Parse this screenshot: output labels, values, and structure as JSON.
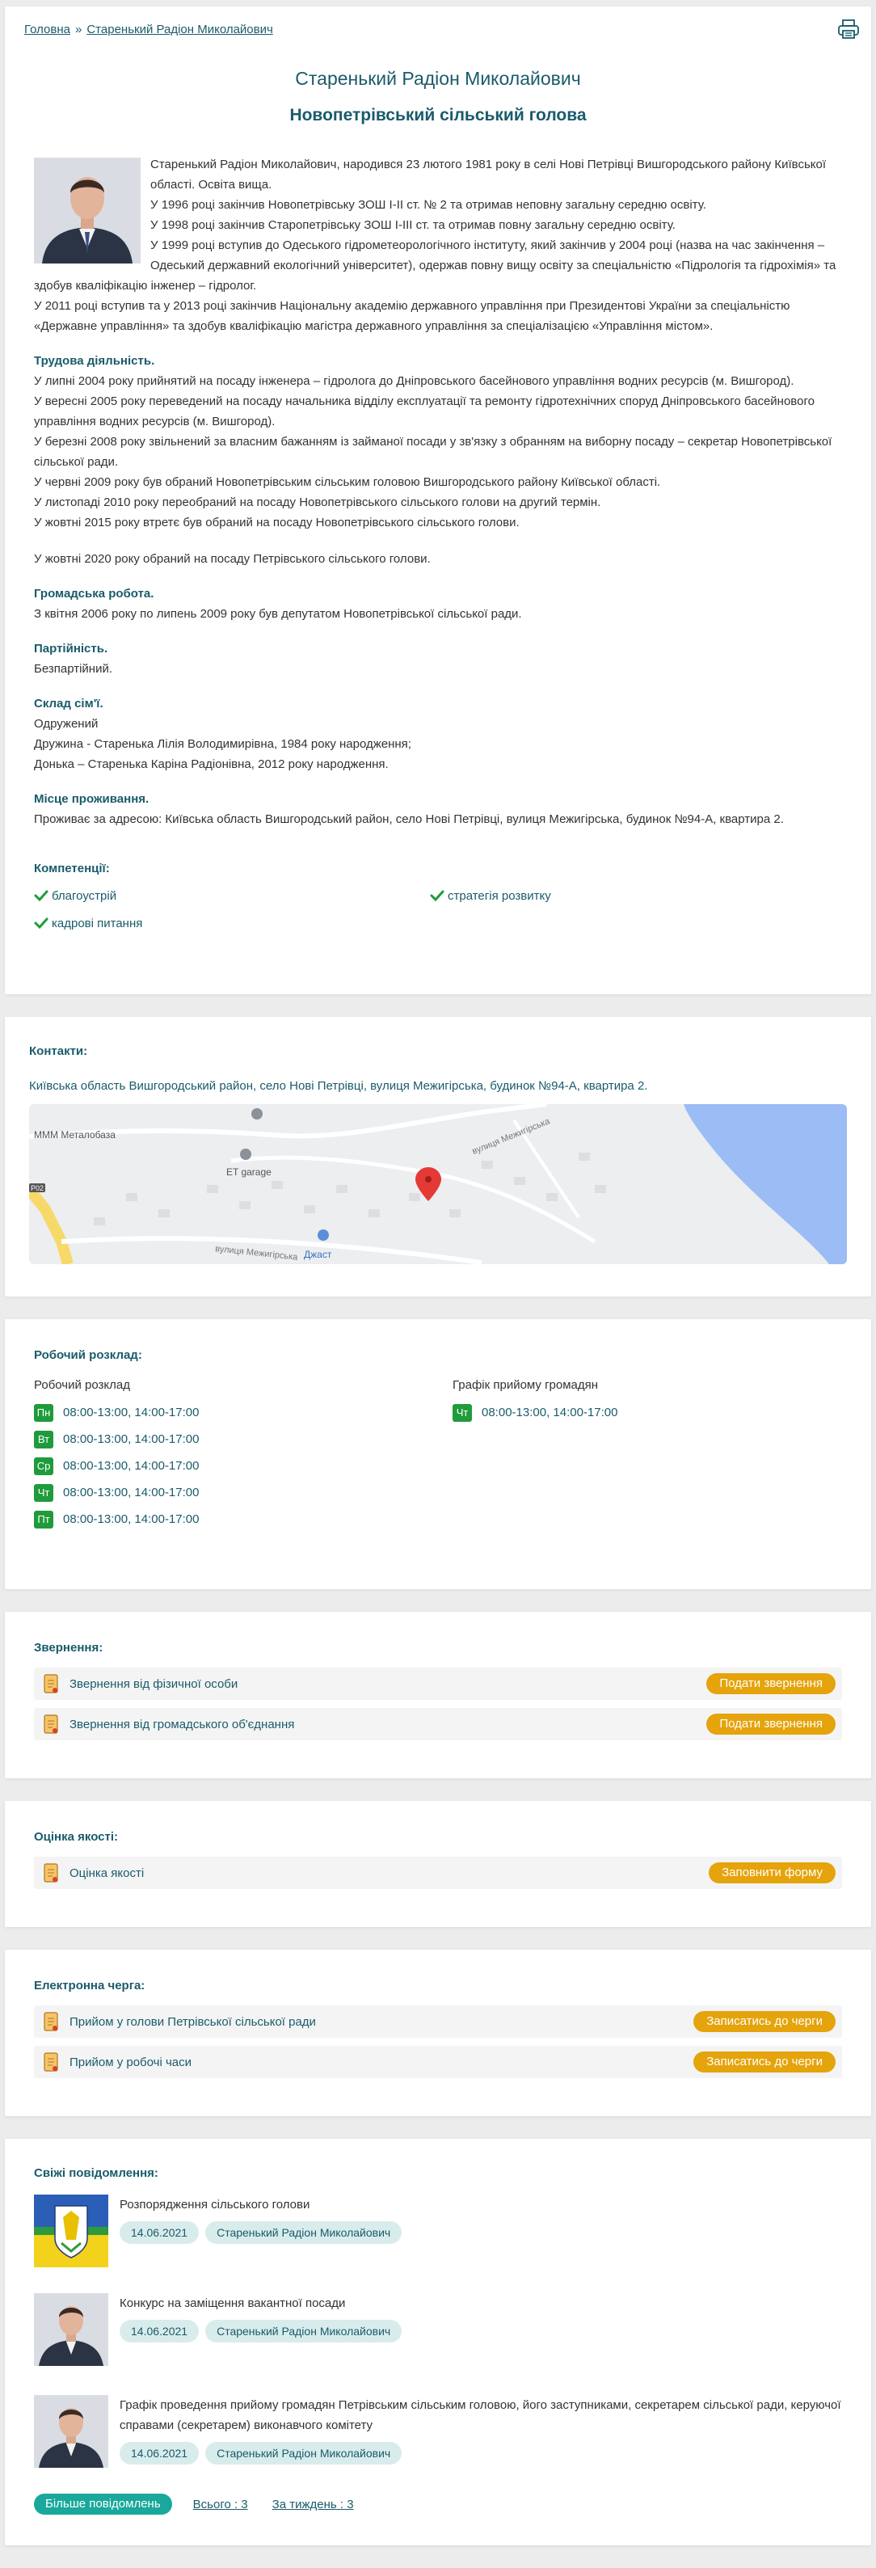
{
  "breadcrumb": {
    "home": "Головна",
    "sep": "»",
    "current": "Старенький Радіон Миколайович"
  },
  "header": {
    "name": "Старенький Радіон Миколайович",
    "position": "Новопетрівський сільський голова"
  },
  "bio": {
    "intro": [
      "Старенький Радіон Миколайович, народився 23 лютого 1981 року в селі Нові Петрівці Вишгородського району Київської області. Освіта вища.",
      "У 1996 році закінчив Новопетрівську ЗОШ І-ІІ ст. № 2 та отримав неповну загальну середню освіту.",
      "У 1998 році закінчив Старопетрівську ЗОШ І-ІІІ ст. та отримав повну загальну середню освіту.",
      "У 1999 році вступив до Одеського гідрометеорологічного інституту, який закінчив у 2004 році (назва на час закінчення – Одеський державний екологічний університет), одержав повну вищу освіту за спеціальністю «Підрологія та гідрохімія» та здобув кваліфікацію інженер – гідролог.",
      "У 2011 році вступив та у 2013 році закінчив Національну академію державного управління при Президентові України за спеціальністю «Державне управління» та здобув кваліфікацію магістра державного управління за спеціалізацією «Управління містом»."
    ],
    "work_title": "Трудова діяльність.",
    "work": [
      "У липні 2004 року прийнятий на посаду інженера – гідролога до Дніпровського басейнового управління водних ресурсів (м. Вишгород).",
      "У вересні 2005 року переведений на посаду начальника відділу експлуатації та ремонту гідротехнічних споруд Дніпровського басейнового управління водних ресурсів (м. Вишгород).",
      "У березні 2008 року звільнений за власним бажанням із займаної посади у зв'язку з обранням на виборну посаду – секретар Новопетрівської сільської ради.",
      "У червні 2009 року був обраний Новопетрівським сільським головою Вишгородського району Київської області.",
      "У листопаді 2010 року переобраний на посаду Новопетрівського сільського голови на другий термін.",
      "У жовтні 2015 року втретє був обраний на посаду Новопетрівського сільського голови."
    ],
    "work_2020": "У жовтні 2020 року обраний на посаду Петрівського сільського голови.",
    "public_title": "Громадська робота.",
    "public": "З квітня 2006 року по липень 2009 року був депутатом Новопетрівської сільської ради.",
    "party_title": "Партійність.",
    "party": "Безпартійний.",
    "family_title": "Склад сім'ї.",
    "family": [
      "Одружений",
      "Дружина - Старенька Лілія Володимирівна, 1984 року народження;",
      "Донька – Старенька Каріна Радіонівна, 2012 року народження."
    ],
    "residence_title": "Місце проживання.",
    "residence": "Проживає за адресою: Київська область Вишгородський район, село Нові Петрівці, вулиця Межигірська, будинок №94-А, квартира 2."
  },
  "competences": {
    "title": "Компетенції:",
    "items": [
      "благоустрій",
      "стратегія розвитку",
      "кадрові питання"
    ]
  },
  "contacts": {
    "title": "Контакти:",
    "address": "Київська область Вишгородський район, село Нові Петрівці, вулиця Межигірська, будинок №94-А, квартира 2.",
    "map_labels": {
      "a": "МММ Металобаза",
      "b": "ET garage",
      "c": "вулиця Межигірська",
      "d": "вулиця Межигірська",
      "e": "Джаст",
      "f": "P02"
    }
  },
  "schedule": {
    "title": "Робочий розклад:",
    "work_title": "Робочий розклад",
    "reception_title": "Графік прийому громадян",
    "work": [
      {
        "day": "Пн",
        "time": "08:00-13:00, 14:00-17:00"
      },
      {
        "day": "Вт",
        "time": "08:00-13:00, 14:00-17:00"
      },
      {
        "day": "Ср",
        "time": "08:00-13:00, 14:00-17:00"
      },
      {
        "day": "Чт",
        "time": "08:00-13:00, 14:00-17:00"
      },
      {
        "day": "Пт",
        "time": "08:00-13:00, 14:00-17:00"
      }
    ],
    "reception": [
      {
        "day": "Чт",
        "time": "08:00-13:00, 14:00-17:00"
      }
    ]
  },
  "appeals": {
    "title": "Звернення:",
    "items": [
      {
        "label": "Звернення від фізичної особи",
        "button": "Подати звернення"
      },
      {
        "label": "Звернення від громадського об'єднання",
        "button": "Подати звернення"
      }
    ]
  },
  "quality": {
    "title": "Оцінка якості:",
    "items": [
      {
        "label": "Оцінка якості",
        "button": "Заповнити форму"
      }
    ]
  },
  "queue": {
    "title": "Електронна черга:",
    "items": [
      {
        "label": "Прийом у голови Петрівської сільської ради",
        "button": "Записатись до черги"
      },
      {
        "label": "Прийом у робочі часи",
        "button": "Записатись до черги"
      }
    ]
  },
  "news": {
    "title": "Свіжі повідомлення:",
    "items": [
      {
        "title": "Розпорядження сільського голови",
        "date": "14.06.2021",
        "author": "Старенький Радіон Миколайович",
        "thumb": "coat-of-arms"
      },
      {
        "title": "Конкурс на заміщення вакантної посади",
        "date": "14.06.2021",
        "author": "Старенький Радіон Миколайович",
        "thumb": "portrait"
      },
      {
        "title": "Графік проведення прийому громадян Петрівським сільським головою, його заступниками, секретарем сільської ради, керуючої справами (секретарем) виконавчого комітету",
        "date": "14.06.2021",
        "author": "Старенький Радіон Миколайович",
        "thumb": "portrait"
      }
    ],
    "more_button": "Більше повідомлень",
    "total_link": "Всього : 3",
    "week_link": "За тиждень : 3"
  },
  "colors": {
    "primary": "#1a5b6b",
    "accent": "#e5a30c",
    "day_badge": "#1f9b3b",
    "more_button": "#19a89b"
  }
}
